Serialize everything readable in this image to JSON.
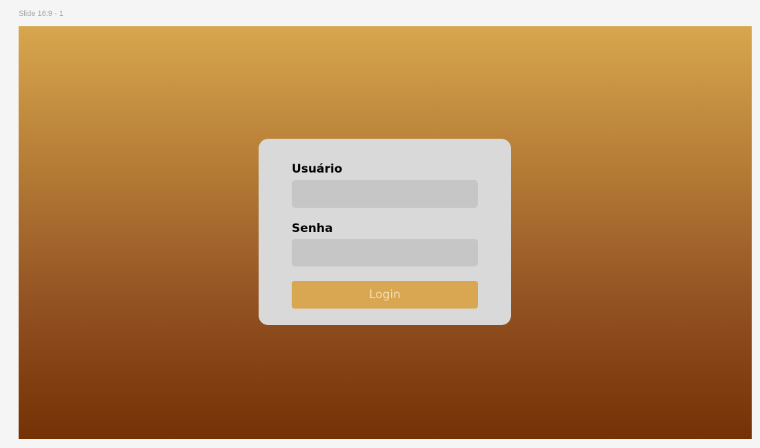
{
  "frame": {
    "label": "Slide 16:9 - 1"
  },
  "login_form": {
    "username_label": "Usuário",
    "username_value": "",
    "password_label": "Senha",
    "password_value": "",
    "login_button_label": "Login"
  },
  "colors": {
    "gradient_top": "#d8a64e",
    "gradient_bottom": "#743105",
    "card_background": "#d9d9d9",
    "input_background": "#c6c6c6",
    "button_background": "#d9a651",
    "button_text": "#f6dfb3"
  }
}
